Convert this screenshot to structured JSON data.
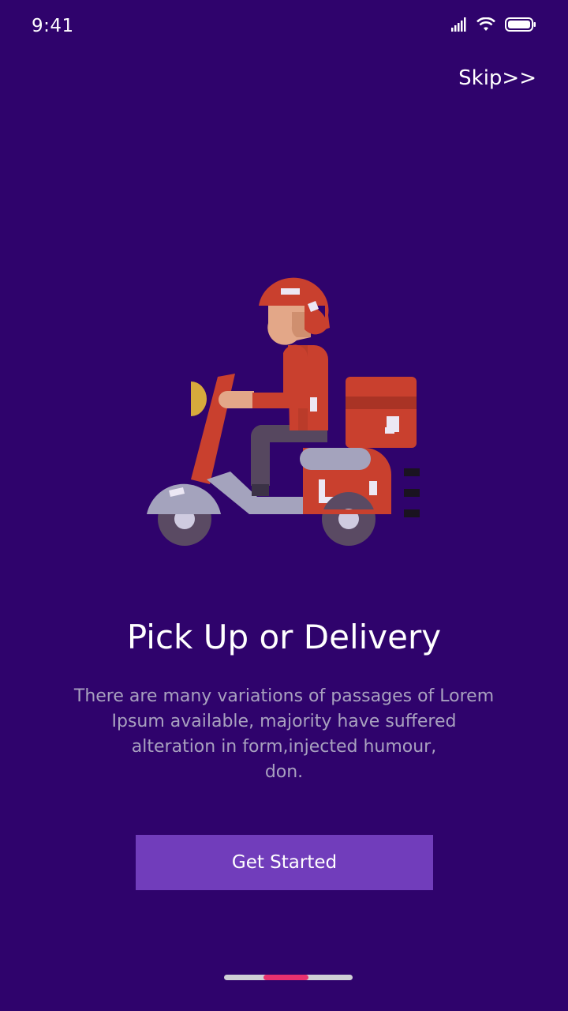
{
  "status_bar": {
    "time": "9:41"
  },
  "skip_label": "Skip>>",
  "illustration": {
    "icon": "delivery-scooter-icon"
  },
  "onboarding": {
    "title": "Pick Up or Delivery",
    "description_lines": [
      "There are many variations of passages of Lorem",
      "Ipsum available,  majority have suffered",
      "alteration in  form,injected humour,",
      "don."
    ],
    "cta_label": "Get Started"
  },
  "pager": {
    "total_pages": 3,
    "current_page": 2
  },
  "colors": {
    "background": "#2f036c",
    "button": "#713dbb",
    "indicator_active": "#e8316f",
    "indicator_track": "#cfcfd6",
    "description_text": "#a8a1bf"
  }
}
